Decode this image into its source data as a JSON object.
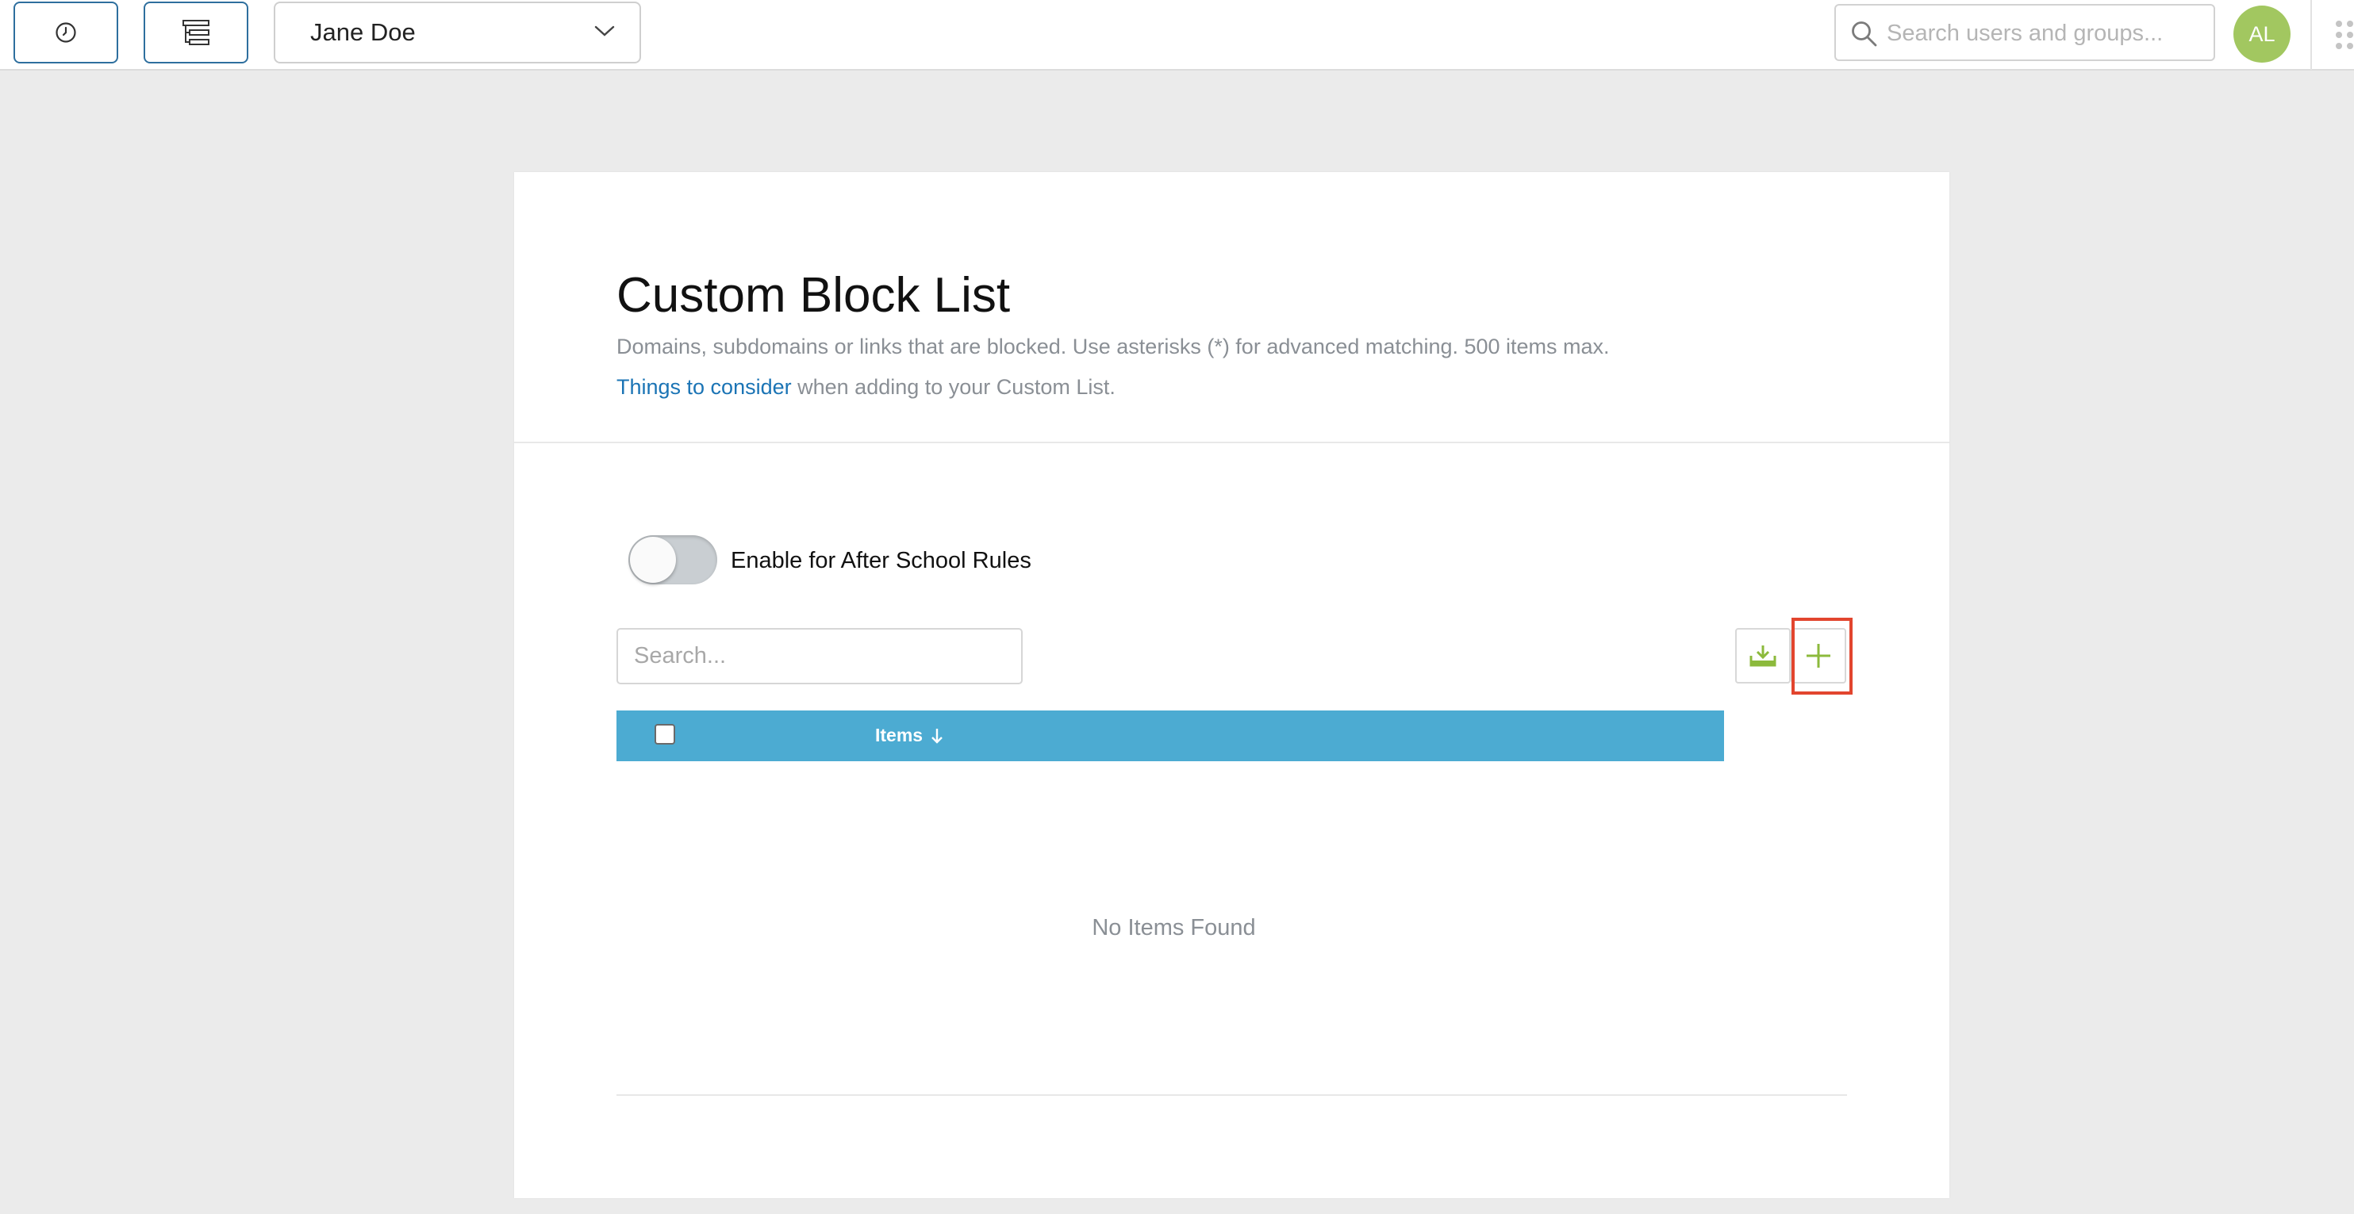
{
  "header": {
    "user_select": {
      "value": "Jane Doe"
    },
    "search": {
      "placeholder": "Search users and groups..."
    },
    "avatar": {
      "initials": "AL",
      "color": "#a2c760"
    }
  },
  "card": {
    "title": "Custom Block List",
    "description": "Domains, subdomains or links that are blocked. Use asterisks (*) for advanced matching. 500 items max.",
    "consider_link": "Things to consider",
    "consider_suffix": " when adding to your Custom List.",
    "toggle": {
      "label": "Enable for After School Rules",
      "enabled": false
    },
    "list_search": {
      "placeholder": "Search..."
    },
    "table": {
      "columns": [
        {
          "label": "Items",
          "sort": "descending"
        }
      ],
      "header_color": "#4cabd2",
      "rows": []
    },
    "empty_message": "No Items Found"
  },
  "icons": {
    "history": "clock-icon",
    "tree": "tree-list-icon",
    "chevron": "chevron-down-icon",
    "search": "search-icon",
    "apps": "apps-grid-icon",
    "download": "download-icon",
    "add": "plus-icon",
    "sort": "arrow-down-icon"
  },
  "colors": {
    "accent": "#8cba3c",
    "link": "#1b74b5",
    "highlight": "#e2452e"
  }
}
